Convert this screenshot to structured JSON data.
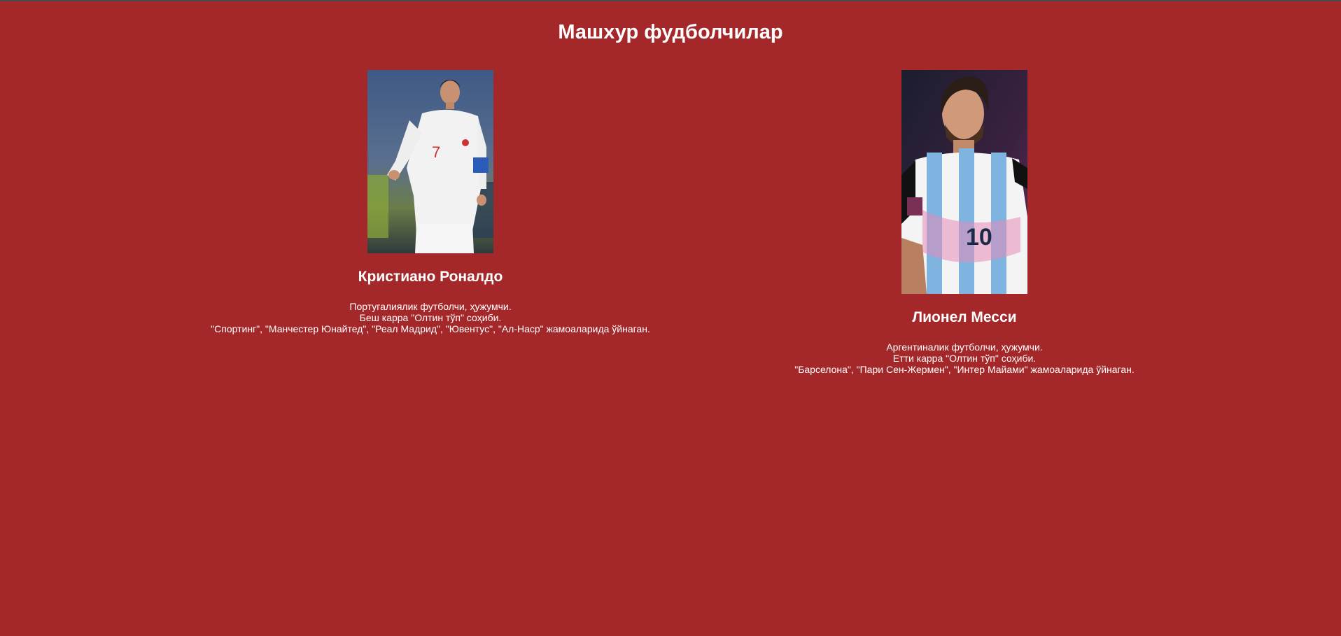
{
  "page": {
    "title": "Машхур фудболчилар",
    "background": "#a4282a"
  },
  "players": [
    {
      "name": "Кристиано Роналдо",
      "photo_alt": "Кристиано Роналдо",
      "lines": [
        "Португалиялик футболчи, ҳужумчи.",
        "Беш карра \"Олтин тўп\" соҳиби.",
        "\"Спортинг\", \"Манчестер Юнайтед\", \"Реал Мадрид\", \"Ювентус\", \"Ал-Наср\" жамоаларида ўйнаган."
      ]
    },
    {
      "name": "Лионел Месси",
      "photo_alt": "Лионел Месси",
      "lines": [
        "Аргентиналик футболчи, ҳужумчи.",
        "Етти карра \"Олтин тўп\" соҳиби.",
        "\"Барселона\", \"Пари Сен-Жермен\", \"Интер Майами\" жамоаларида ўйнаган."
      ]
    }
  ]
}
